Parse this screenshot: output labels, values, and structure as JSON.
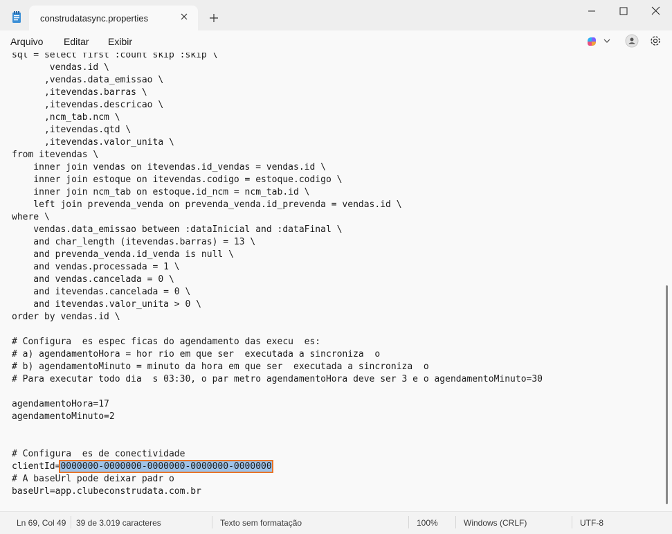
{
  "tab": {
    "title": "construdatasync.properties"
  },
  "menu": {
    "items": [
      "Arquivo",
      "Editar",
      "Exibir"
    ]
  },
  "editor": {
    "lines_before": [
      "sql = select first :count skip :skip \\",
      "       vendas.id \\",
      "      ,vendas.data_emissao \\",
      "      ,itevendas.barras \\",
      "      ,itevendas.descricao \\",
      "      ,ncm_tab.ncm \\",
      "      ,itevendas.qtd \\",
      "      ,itevendas.valor_unita \\",
      "from itevendas \\",
      "    inner join vendas on itevendas.id_vendas = vendas.id \\",
      "    inner join estoque on itevendas.codigo = estoque.codigo \\",
      "    inner join ncm_tab on estoque.id_ncm = ncm_tab.id \\",
      "    left join prevenda_venda on prevenda_venda.id_prevenda = vendas.id \\",
      "where \\",
      "    vendas.data_emissao between :dataInicial and :dataFinal \\",
      "    and char_length (itevendas.barras) = 13 \\",
      "    and prevenda_venda.id_venda is null \\",
      "    and vendas.processada = 1 \\",
      "    and vendas.cancelada = 0 \\",
      "    and itevendas.cancelada = 0 \\",
      "    and itevendas.valor_unita > 0 \\",
      "order by vendas.id \\",
      "",
      "# Configura  es espec ficas do agendamento das execu  es:",
      "# a) agendamentoHora = hor rio em que ser  executada a sincroniza  o",
      "# b) agendamentoMinuto = minuto da hora em que ser  executada a sincroniza  o",
      "# Para executar todo dia  s 03:30, o par metro agendamentoHora deve ser 3 e o agendamentoMinuto=30",
      "",
      "agendamentoHora=17",
      "agendamentoMinuto=2",
      "",
      "",
      "# Configura  es de conectividade"
    ],
    "client_prefix": "clientId=",
    "client_value": "0000000-0000000-0000000-0000000-0000000",
    "lines_after": [
      "# A baseUrl pode deixar padr o",
      "baseUrl=app.clubeconstrudata.com.br"
    ]
  },
  "status": {
    "position": "Ln 69, Col 49",
    "selection": "39 de 3.019 caracteres",
    "format": "Texto sem formatação",
    "zoom": "100%",
    "line_ending": "Windows (CRLF)",
    "encoding": "UTF-8"
  }
}
